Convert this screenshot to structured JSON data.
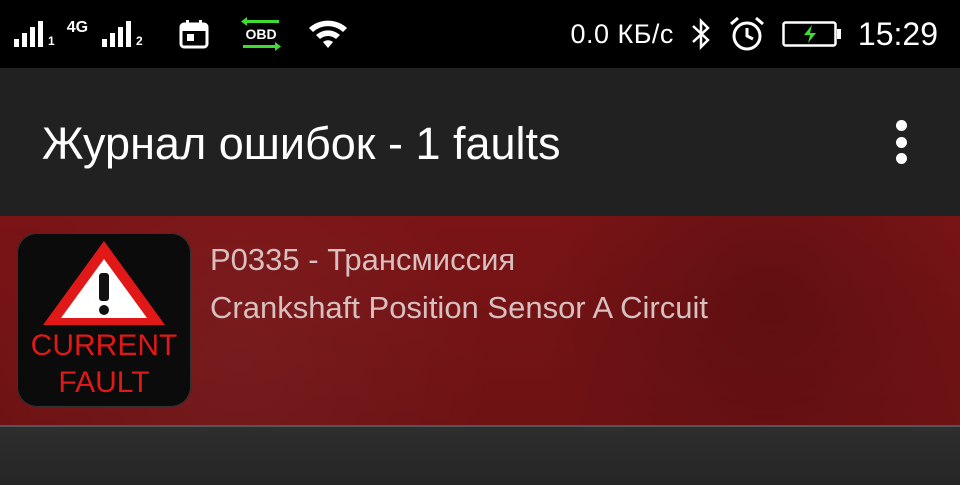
{
  "status_bar": {
    "network_type": "4G",
    "sim1_label": "1",
    "sim2_label": "2",
    "obd_label": "OBD",
    "data_speed": "0.0 КБ/с",
    "time": "15:29",
    "icons": [
      "signal-icon",
      "signal-icon",
      "calendar-icon",
      "obd-icon",
      "wifi-icon",
      "bluetooth-icon",
      "alarm-icon",
      "battery-charging-icon"
    ]
  },
  "app_bar": {
    "title": "Журнал ошибок - 1 faults",
    "menu_icon": "more-vert-icon"
  },
  "faults": [
    {
      "badge_line1": "CURRENT",
      "badge_line2": "FAULT",
      "code": "P0335 - Трансмиссия",
      "description": "Crankshaft Position Sensor A Circuit"
    }
  ],
  "colors": {
    "status_bar_bg": "#000000",
    "app_bar_bg": "#212121",
    "fault_row_bg": "#751315",
    "fault_text": "#d7c0bf",
    "warning_red": "#e01818",
    "battery_green": "#3ddc30"
  }
}
